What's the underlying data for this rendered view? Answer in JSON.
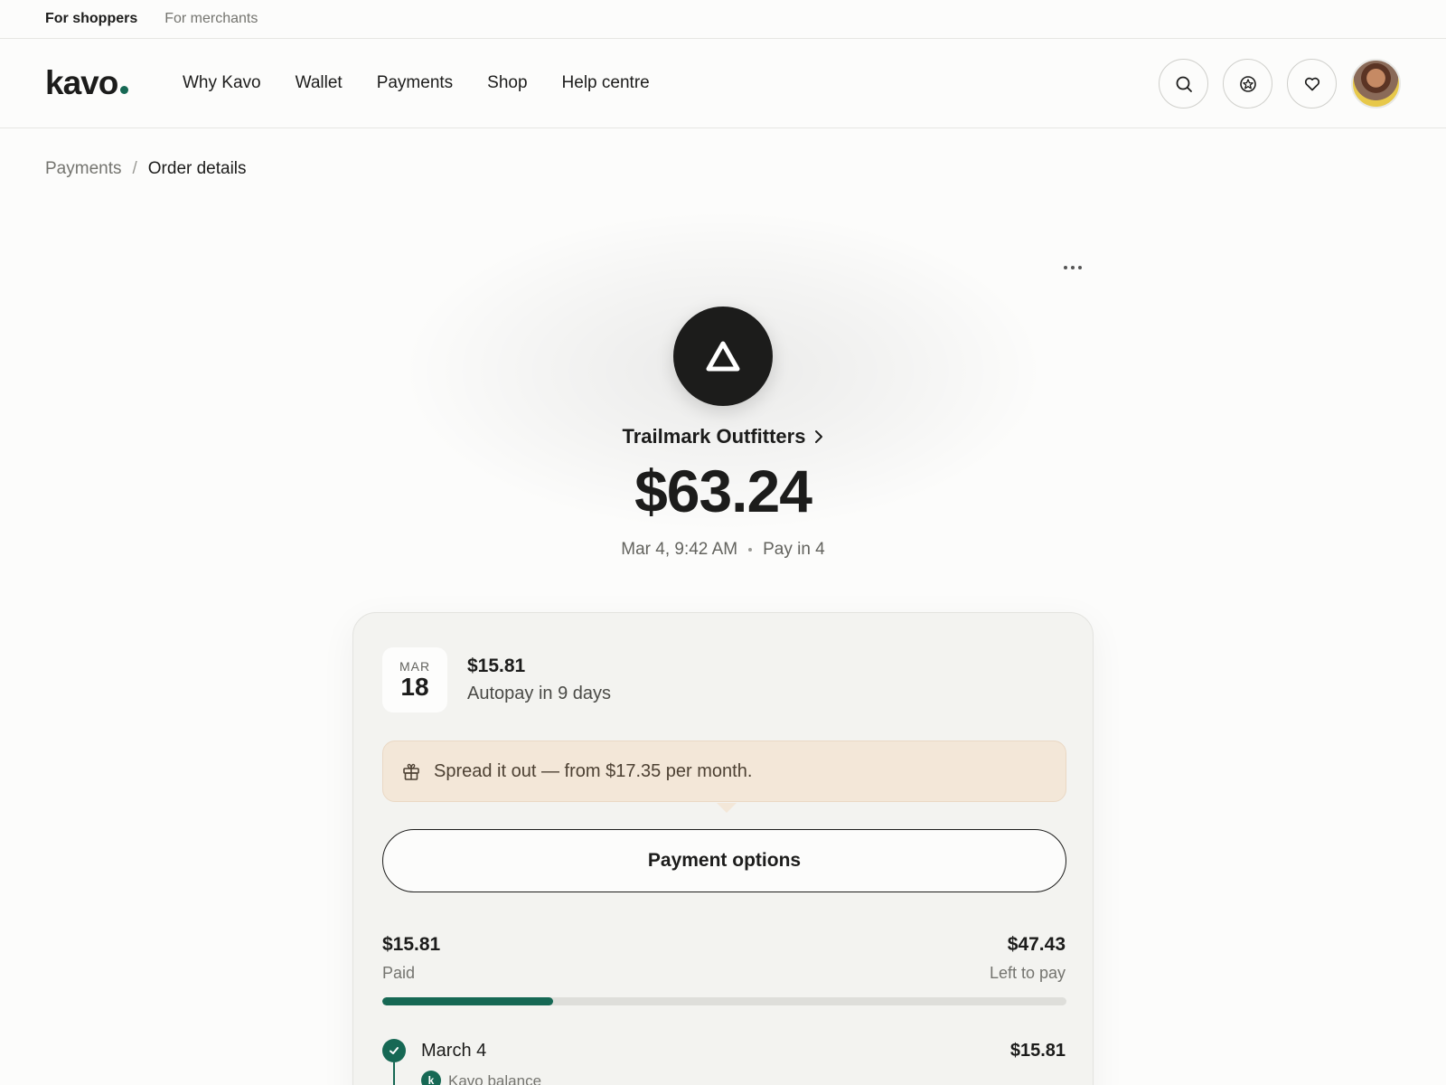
{
  "topbar": {
    "shoppers": "For shoppers",
    "merchants": "For merchants"
  },
  "logo": {
    "text": "kavo"
  },
  "nav": {
    "items": [
      {
        "label": "Why Kavo"
      },
      {
        "label": "Wallet"
      },
      {
        "label": "Payments"
      },
      {
        "label": "Shop"
      },
      {
        "label": "Help centre"
      }
    ]
  },
  "header_icons": [
    "search-icon",
    "rewards-star-icon",
    "heart-icon",
    "avatar"
  ],
  "breadcrumb": {
    "parent": "Payments",
    "separator": "/",
    "current": "Order details"
  },
  "order": {
    "merchant": "Trailmark Outfitters",
    "total": "$63.24",
    "date": "Mar 4, 9:42 AM",
    "plan": "Pay in 4"
  },
  "next_payment": {
    "month": "MAR",
    "day": "18",
    "amount": "$15.81",
    "status": "Autopay in 9 days"
  },
  "promo": {
    "text": "Spread it out — from $17.35 per month.",
    "icon": "gift-icon"
  },
  "payment_options_label": "Payment options",
  "progress": {
    "paid_amount": "$15.81",
    "paid_label": "Paid",
    "left_amount": "$47.43",
    "left_label": "Left to pay",
    "fraction_paid": 0.25
  },
  "installments": [
    {
      "date": "March 4",
      "amount": "$15.81",
      "source": "Kavo balance",
      "source_initial": "k",
      "status": "paid"
    }
  ],
  "colors": {
    "accent": "#166854",
    "promo_bg": "#f3e7d8",
    "card_bg": "#f3f3f0"
  }
}
